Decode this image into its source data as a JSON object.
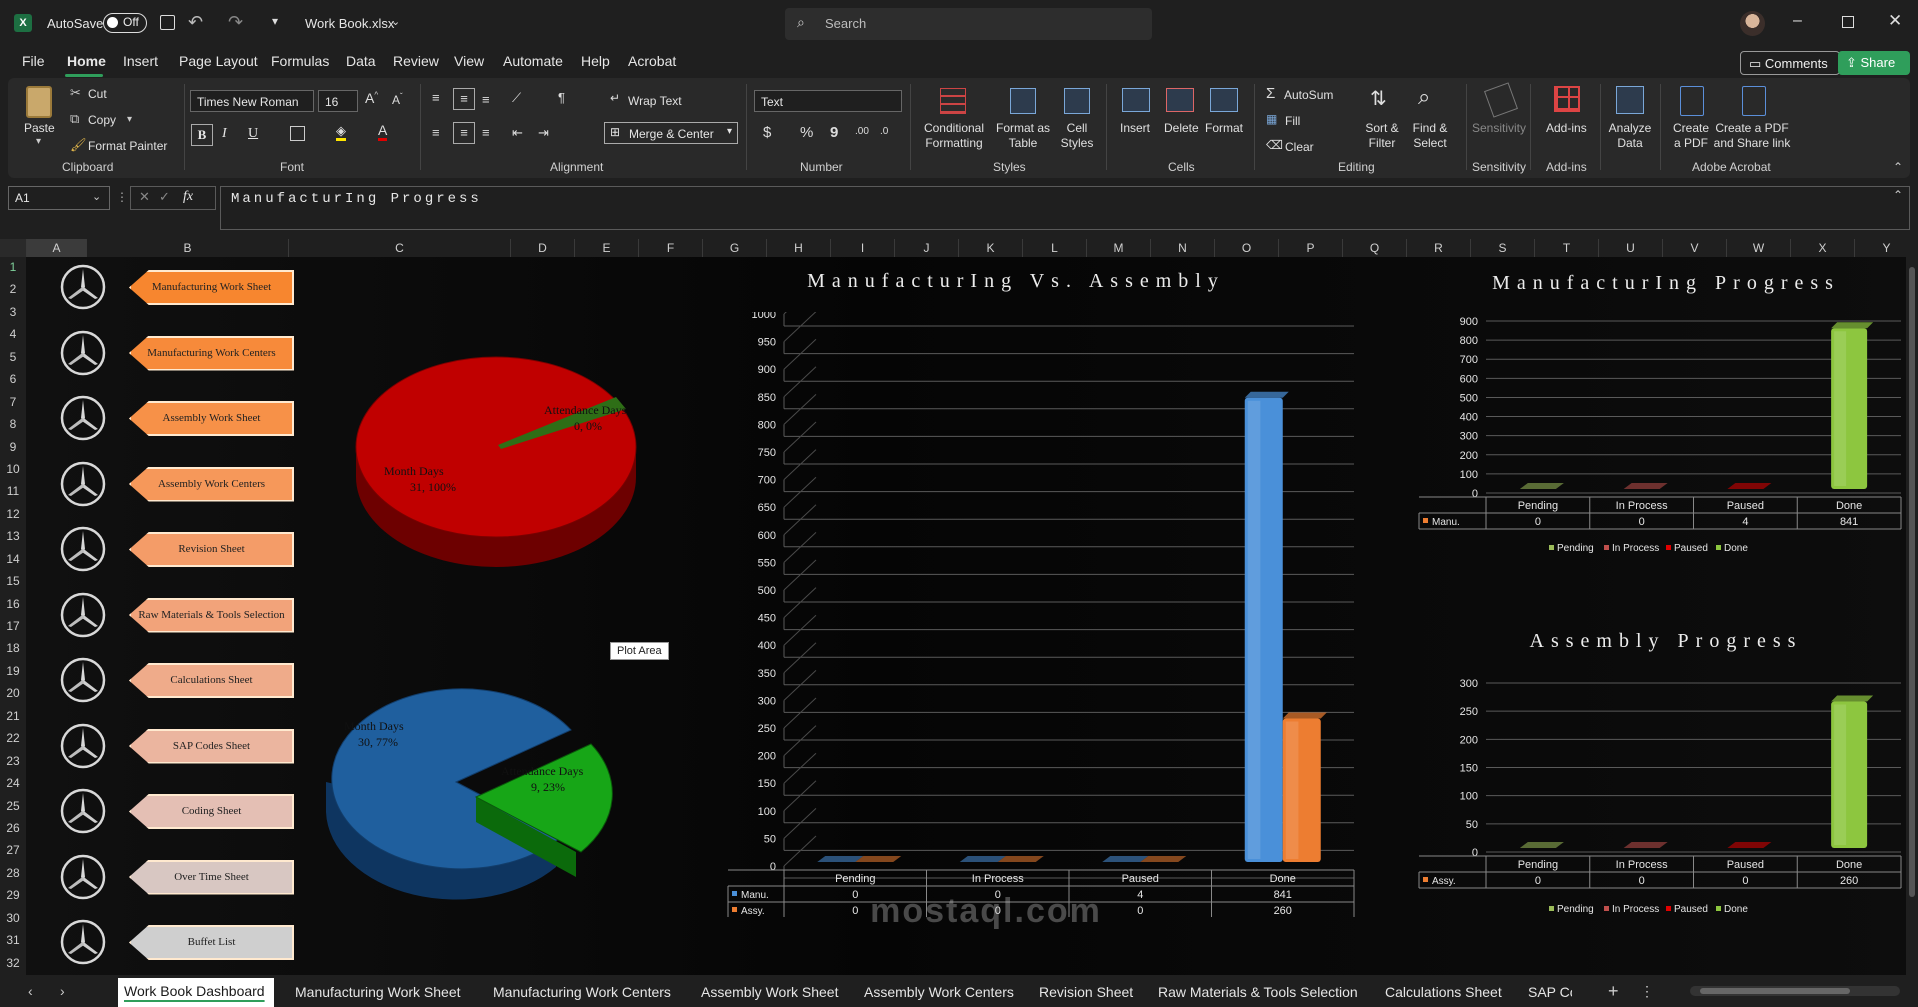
{
  "titlebar": {
    "autosave_label": "AutoSave",
    "autosave_state": "Off",
    "filename": "Work Book.xlsx",
    "search_placeholder": "Search"
  },
  "menu": {
    "items": [
      "File",
      "Home",
      "Insert",
      "Page Layout",
      "Formulas",
      "Data",
      "Review",
      "View",
      "Automate",
      "Help",
      "Acrobat"
    ],
    "active": "Home",
    "comments": "Comments",
    "share": "Share"
  },
  "ribbon": {
    "clipboard": {
      "paste": "Paste",
      "cut": "Cut",
      "copy": "Copy",
      "format_painter": "Format Painter",
      "group": "Clipboard"
    },
    "font": {
      "family": "Times New Roman",
      "size": "16",
      "group": "Font",
      "bold": "B",
      "italic": "I",
      "underline": "U"
    },
    "alignment": {
      "wrap": "Wrap Text",
      "merge": "Merge & Center",
      "group": "Alignment"
    },
    "number": {
      "format": "Text",
      "currency": "$",
      "percent": "%",
      "comma": "9",
      "group": "Number"
    },
    "styles": {
      "conditional": "Conditional Formatting",
      "format_table": "Format as Table",
      "cell_styles": "Cell Styles",
      "group": "Styles"
    },
    "cells": {
      "insert": "Insert",
      "delete": "Delete",
      "format": "Format",
      "group": "Cells"
    },
    "editing": {
      "autosum": "AutoSum",
      "fill": "Fill",
      "clear": "Clear",
      "sort": "Sort & Filter",
      "find": "Find & Select",
      "group": "Editing"
    },
    "sensitivity": {
      "label": "Sensitivity",
      "group": "Sensitivity"
    },
    "addins": {
      "label": "Add-ins",
      "group": "Add-ins"
    },
    "analyze": {
      "label": "Analyze Data"
    },
    "acrobat": {
      "create": "Create a PDF",
      "share": "Create a PDF and Share link",
      "group": "Adobe Acrobat"
    }
  },
  "formula_bar": {
    "cell": "A1",
    "fx": "fx",
    "content": "ManufacturIng Progress"
  },
  "columns": [
    "A",
    "B",
    "C",
    "D",
    "E",
    "F",
    "G",
    "H",
    "I",
    "J",
    "K",
    "L",
    "M",
    "N",
    "O",
    "P",
    "Q",
    "R",
    "S",
    "T",
    "U",
    "V",
    "W",
    "X",
    "Y"
  ],
  "rows": [
    "1",
    "2",
    "3",
    "4",
    "5",
    "6",
    "7",
    "8",
    "9",
    "10",
    "11",
    "12",
    "13",
    "14",
    "15",
    "16",
    "17",
    "18",
    "19",
    "20",
    "21",
    "22",
    "23",
    "24",
    "25",
    "26",
    "27",
    "28",
    "29",
    "30",
    "31",
    "32"
  ],
  "nav_buttons": [
    {
      "label": "Manufacturing Work Sheet",
      "color": "#f7862f"
    },
    {
      "label": "Manufacturing Work Centers",
      "color": "#f78a3a"
    },
    {
      "label": "Assembly Work Sheet",
      "color": "#f79148"
    },
    {
      "label": "Assembly Work Centers",
      "color": "#f6985a"
    },
    {
      "label": "Revision Sheet",
      "color": "#f49c68"
    },
    {
      "label": "Raw Materials & Tools Selection",
      "color": "#f2a37a"
    },
    {
      "label": "Calculations Sheet",
      "color": "#efab8a"
    },
    {
      "label": "SAP Codes Sheet",
      "color": "#ebb59f"
    },
    {
      "label": "Coding Sheet",
      "color": "#e4bfb4"
    },
    {
      "label": "Over Time Sheet",
      "color": "#d8c7c2"
    },
    {
      "label": "Buffet List",
      "color": "#cfcfcf"
    }
  ],
  "tooltip": "Plot Area",
  "chart_data": [
    {
      "type": "pie",
      "slices": [
        {
          "name": "Month Days",
          "value": 31,
          "pct": "100%",
          "label": "Month Days, 31, 100%",
          "color": "#c00000"
        },
        {
          "name": "Attendance Days",
          "value": 0,
          "pct": "0%",
          "label": "Attendance Days, 0, 0%",
          "color": "#2e6e16"
        }
      ]
    },
    {
      "type": "pie",
      "slices": [
        {
          "name": "Month Days",
          "value": 30,
          "pct": "77%",
          "label": "Month Days, 30, 77%",
          "color": "#1f5f9e"
        },
        {
          "name": "Attendance Days",
          "value": 9,
          "pct": "23%",
          "label": "Attendance Days, 9, 23%",
          "color": "#17a617"
        }
      ]
    },
    {
      "type": "bar",
      "title": "ManufacturIng Vs. Assembly",
      "categories": [
        "Pending",
        "In Process",
        "Paused",
        "Done"
      ],
      "series": [
        {
          "name": "Manu.",
          "values": [
            0,
            0,
            4,
            841
          ],
          "color": "#4a90d9"
        },
        {
          "name": "Assy.",
          "values": [
            0,
            0,
            0,
            260
          ],
          "color": "#ed7d31"
        }
      ],
      "ylim": [
        0,
        1000
      ],
      "yticks": [
        "1000",
        "950",
        "900",
        "850",
        "800",
        "750",
        "700",
        "650",
        "600",
        "550",
        "500",
        "450",
        "400",
        "350",
        "300",
        "250",
        "200",
        "150",
        "100",
        "50",
        "0"
      ],
      "legend": "bottom",
      "grid": true
    },
    {
      "type": "bar",
      "title": "ManufacturIng Progress",
      "categories": [
        "Pending",
        "In Process",
        "Paused",
        "Done"
      ],
      "series": [
        {
          "name": "Manu.",
          "values": [
            0,
            0,
            4,
            841
          ]
        }
      ],
      "point_colors": [
        "#9bbb59",
        "#c0504d",
        "#e00000",
        "#8dc63f"
      ],
      "ylim": [
        0,
        900
      ],
      "yticks": [
        "900",
        "800",
        "700",
        "600",
        "500",
        "400",
        "300",
        "200",
        "100",
        "0"
      ],
      "legend": "bottom",
      "grid": true
    },
    {
      "type": "bar",
      "title": "Assembly Progress",
      "categories": [
        "Pending",
        "In Process",
        "Paused",
        "Done"
      ],
      "series": [
        {
          "name": "Assy.",
          "values": [
            0,
            0,
            0,
            260
          ]
        }
      ],
      "point_colors": [
        "#9bbb59",
        "#c0504d",
        "#e00000",
        "#8dc63f"
      ],
      "ylim": [
        0,
        300
      ],
      "yticks": [
        "300",
        "250",
        "200",
        "150",
        "100",
        "50",
        "0"
      ],
      "legend": "bottom",
      "grid": true
    }
  ],
  "tabs": [
    "Work Book Dashboard",
    "Manufacturing Work Sheet",
    "Manufacturing Work Centers",
    "Assembly Work Sheet",
    "Assembly Work Centers",
    "Revision Sheet",
    "Raw Materials & Tools Selection",
    "Calculations Sheet",
    "SAP Co"
  ],
  "active_tab": "Work Book Dashboard",
  "watermark": "mostaql.com"
}
